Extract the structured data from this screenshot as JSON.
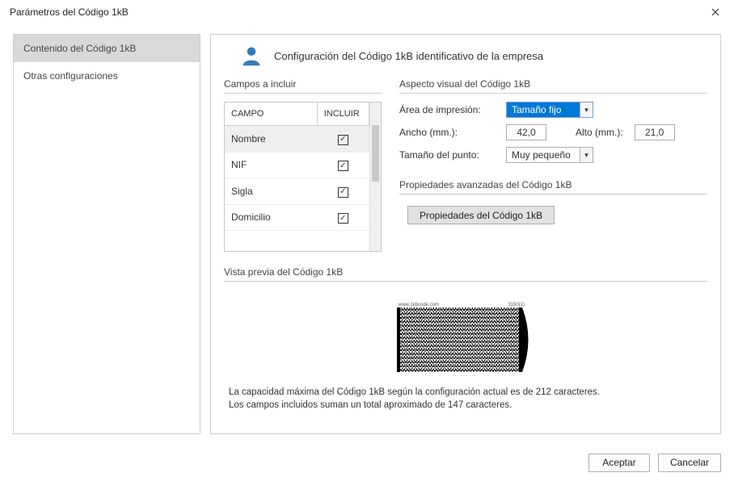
{
  "window": {
    "title": "Parámetros del Código 1kB"
  },
  "sidebar": {
    "items": [
      {
        "label": "Contenido del Código 1kB",
        "selected": true
      },
      {
        "label": "Otras configuraciones",
        "selected": false
      }
    ]
  },
  "header": {
    "text": "Configuración del Código 1kB identificativo de la empresa"
  },
  "fields_section": {
    "title": "Campos a incluir",
    "col_campo": "CAMPO",
    "col_incluir": "INCLUIR",
    "rows": [
      {
        "campo": "Nombre",
        "incluir": true,
        "selected": true
      },
      {
        "campo": "NIF",
        "incluir": true,
        "selected": false
      },
      {
        "campo": "Sigla",
        "incluir": true,
        "selected": false
      },
      {
        "campo": "Domicilio",
        "incluir": true,
        "selected": false
      }
    ]
  },
  "visual_section": {
    "title": "Aspecto visual del Código 1kB",
    "area_label": "Área de impresión:",
    "area_value": "Tamaño fijo",
    "ancho_label": "Ancho (mm.):",
    "ancho_value": "42,0",
    "alto_label": "Alto (mm.):",
    "alto_value": "21,0",
    "punto_label": "Tamaño del punto:",
    "punto_value": "Muy pequeño"
  },
  "advanced_section": {
    "title": "Propiedades avanzadas del Código 1kB",
    "button": "Propiedades del Código 1kB"
  },
  "preview_section": {
    "title": "Vista previa del Código 1kB",
    "top_left_label": "www.1kbcode.com",
    "top_right_label": "3150(1)",
    "note_line1": "La capacidad máxima del Código 1kB según la configuración actual es de 212 caracteres.",
    "note_line2": "Los campos incluidos suman un total aproximado de 147 caracteres."
  },
  "footer": {
    "ok": "Aceptar",
    "cancel": "Cancelar"
  }
}
